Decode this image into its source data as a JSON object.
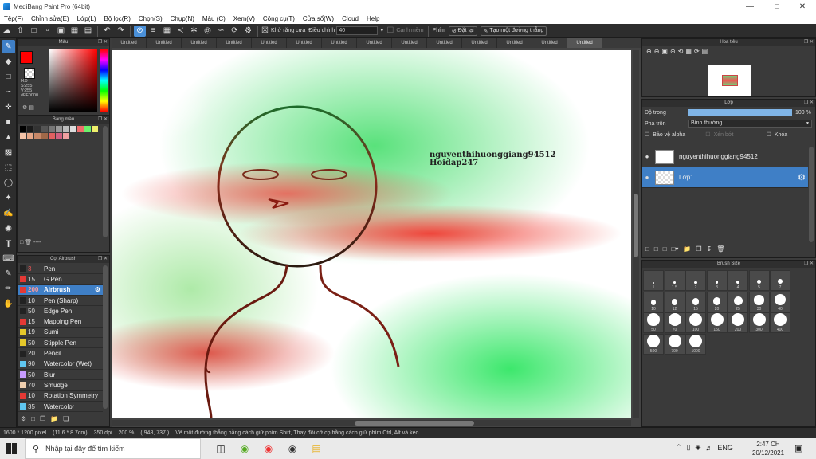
{
  "window": {
    "title": "MediBang Paint Pro (64bit)"
  },
  "menu": [
    "Tệp(F)",
    "Chỉnh sửa(E)",
    "Lớp(L)",
    "Bộ lọc(R)",
    "Chọn(S)",
    "Chụp(N)",
    "Màu (C)",
    "Xem(V)",
    "Công cụ(T)",
    "Cửa sổ(W)",
    "Cloud",
    "Help"
  ],
  "toolbar": {
    "antialias_label": "Khử răng cưa",
    "correction_label": "Điều chỉnh",
    "correction_value": "40",
    "edge_label": "Cạnh mềm",
    "keys_label": "Phím",
    "reset_label": "Đặt lại",
    "straight_line_label": "Tạo một đường thẳng"
  },
  "panels": {
    "color": {
      "title": "Màu",
      "h": "H:0",
      "s": "S:255",
      "v": "V:255",
      "hex": "#FF0000"
    },
    "palette": {
      "title": "Bảng màu",
      "footer": "----"
    },
    "brush": {
      "title": "Cọ: Airbrush",
      "items": [
        {
          "size": "3",
          "name": "Pen",
          "color": "#222222"
        },
        {
          "size": "15",
          "name": "G Pen",
          "color": "#e53935"
        },
        {
          "size": "200",
          "name": "Airbrush",
          "color": "#e53935"
        },
        {
          "size": "10",
          "name": "Pen (Sharp)",
          "color": "#222222"
        },
        {
          "size": "50",
          "name": "Edge Pen",
          "color": "#222222"
        },
        {
          "size": "15",
          "name": "Mapping Pen",
          "color": "#e53935"
        },
        {
          "size": "19",
          "name": "Sumi",
          "color": "#e5c82a"
        },
        {
          "size": "50",
          "name": "Stipple Pen",
          "color": "#e5c82a"
        },
        {
          "size": "20",
          "name": "Pencil",
          "color": "#222222"
        },
        {
          "size": "90",
          "name": "Watercolor (Wet)",
          "color": "#5fc6f0"
        },
        {
          "size": "50",
          "name": "Blur",
          "color": "#c79bff"
        },
        {
          "size": "70",
          "name": "Smudge",
          "color": "#f0d0b0"
        },
        {
          "size": "10",
          "name": "Rotation Symmetry",
          "color": "#e53935"
        },
        {
          "size": "35",
          "name": "Watercolor",
          "color": "#5fc6f0"
        }
      ]
    },
    "navigator": {
      "title": "Hoa tiêu"
    },
    "layer": {
      "title": "Lớp",
      "opacity_label": "Độ trong",
      "opacity_value": "100 %",
      "opacity_fraction": 1.0,
      "blend_label": "Pha trộn",
      "blend_value": "Bình thường",
      "protect_alpha": "Bảo vệ alpha",
      "clip": "Xén bớt",
      "lock": "Khóa",
      "layers": [
        {
          "name": "nguyenthihuonggiang94512"
        },
        {
          "name": "Lớp1"
        }
      ]
    },
    "brush_size": {
      "title": "Brush Size",
      "sizes": [
        "1",
        "1.5",
        "2",
        "3",
        "4",
        "5",
        "7",
        "10",
        "12",
        "15",
        "20",
        "25",
        "30",
        "40",
        "50",
        "70",
        "100",
        "150",
        "200",
        "300",
        "400",
        "500",
        "700",
        "1000"
      ]
    }
  },
  "tabs": [
    "Untitled",
    "Untitled",
    "Untitled",
    "Untitled",
    "Untitled",
    "Untitled",
    "Untitled",
    "Untitled",
    "Untitled",
    "Untitled",
    "Untitled",
    "Untitled",
    "Untitled",
    "Untitled"
  ],
  "canvas": {
    "watermark_line1": "nguyenthihuonggiang94512",
    "watermark_line2": "Hoidap247"
  },
  "status": {
    "size": "1600 * 1200 pixel",
    "cm": "(11.6 * 8.7cm)",
    "dpi": "350 dpi",
    "zoom": "200 %",
    "coords": "( 948, 737 )",
    "hint": "Vẽ một đường thẳng bằng cách giữ phím Shift, Thay đổi cỡ cọ bằng cách giữ phím Ctrl, Alt và kéo"
  },
  "taskbar": {
    "search_placeholder": "Nhập tại đây để tìm kiếm",
    "lang": "ENG",
    "time": "2:47 CH",
    "date": "20/12/2021"
  },
  "colors": {
    "accent": "#3f7fc6",
    "primary_color": "#FF0000"
  }
}
